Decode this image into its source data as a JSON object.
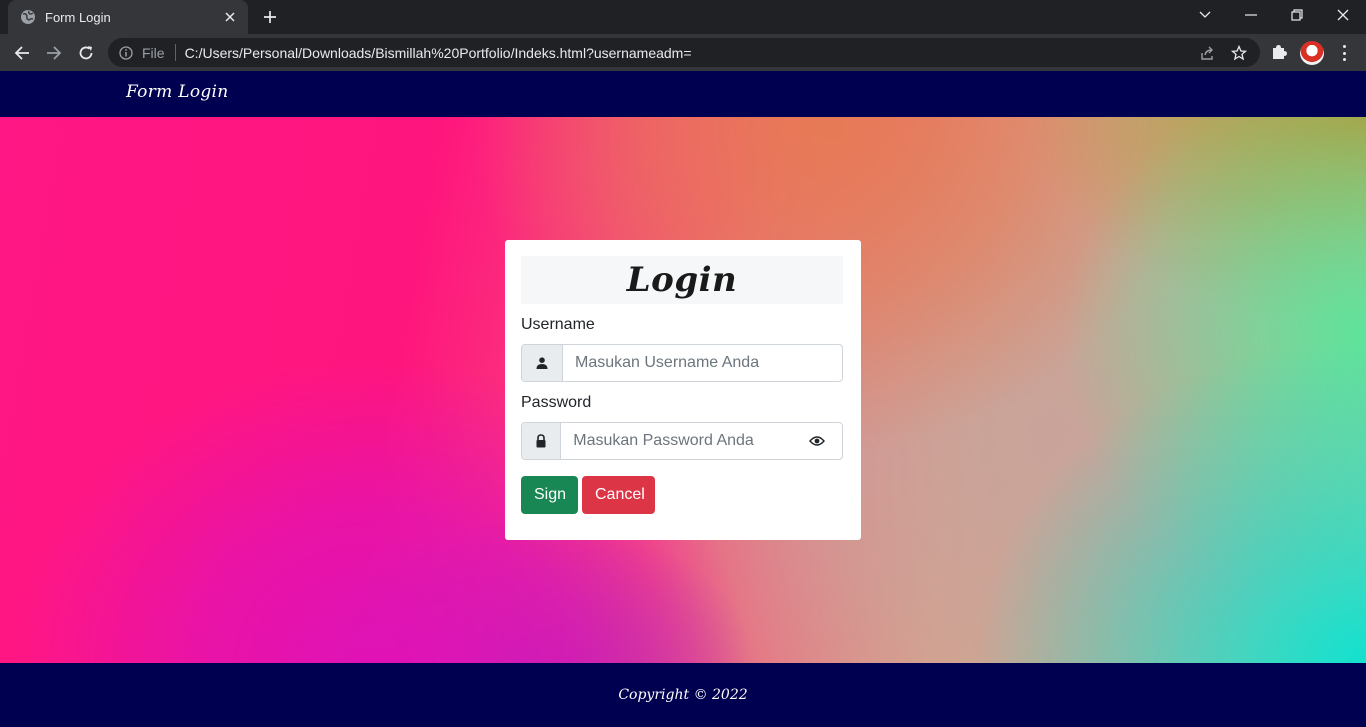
{
  "browser": {
    "tab": {
      "title": "Form Login",
      "favicon": "globe-icon"
    },
    "address_bar": {
      "scheme_label": "File",
      "url": "C:/Users/Personal/Downloads/Bismillah%20Portfolio/Indeks.html?usernameadm="
    },
    "icons": [
      "back-icon",
      "forward-icon",
      "reload-icon",
      "info-icon",
      "share-icon",
      "star-icon",
      "puzzle-icon",
      "new-tab-icon",
      "close-icon",
      "chevron-down-icon",
      "minimize-icon",
      "restore-icon",
      "window-close-icon",
      "menu-icon"
    ]
  },
  "site": {
    "brand": "Form Login",
    "colors": {
      "nav": "#000050",
      "footer": "#000050",
      "sign": "#198754",
      "cancel": "#dc3545"
    }
  },
  "login": {
    "title": "Login",
    "username": {
      "label": "Username",
      "placeholder": "Masukan Username Anda",
      "icon": "user-icon"
    },
    "password": {
      "label": "Password",
      "placeholder": "Masukan Password Anda",
      "icon": "lock-icon",
      "toggle_icon": "eye-icon"
    },
    "sign_label": "Sign",
    "cancel_label": "Cancel"
  },
  "footer": {
    "text": "Copyright © 2022"
  }
}
